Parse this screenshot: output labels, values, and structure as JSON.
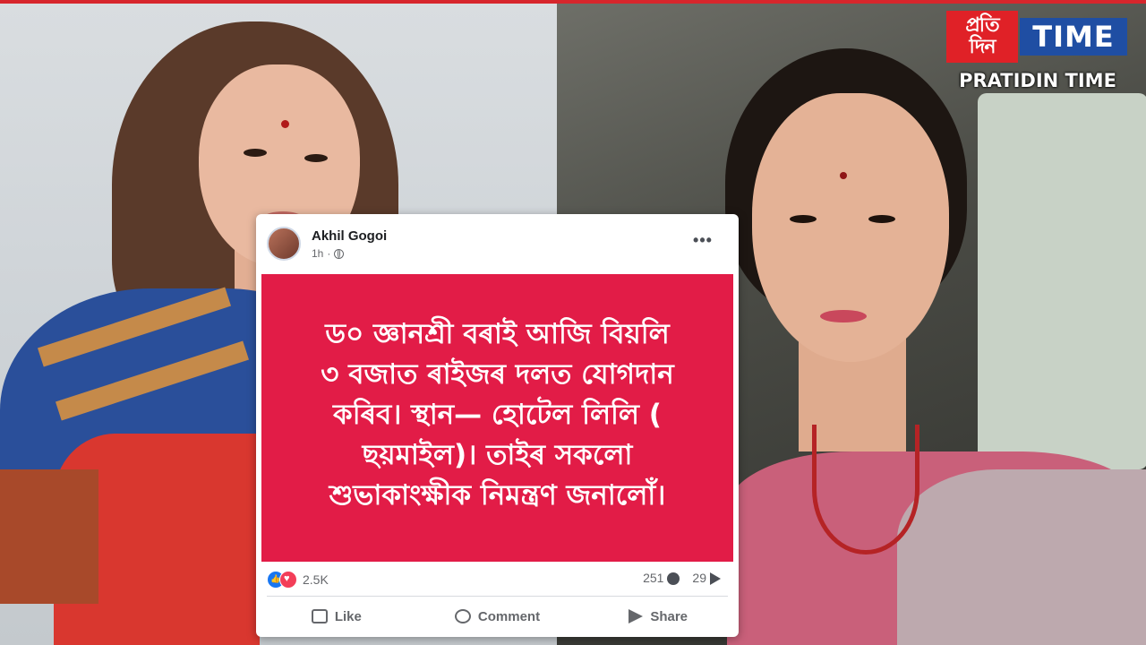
{
  "logo": {
    "mark_line1": "প্রতি",
    "mark_line2": "দিন",
    "time": "TIME",
    "subtitle": "PRATIDIN TIME",
    "brand_red": "#e02127",
    "brand_blue": "#1f4ea3"
  },
  "post": {
    "author": "Akhil Gogoi",
    "time": "1h",
    "audience_icon": "globe-icon",
    "more_label": "•••",
    "background_color": "#e21c47",
    "text_lines": [
      "ড০ জ্ঞানশ্ৰী বৰাই আজি বিয়লি",
      "৩ বজাত ৰাইজৰ দলত যোগদান",
      "কৰিব। স্থান— হোটেল লিলি (",
      "ছয়মাইল)। তাইৰ সকলো",
      "শুভাকাংক্ষীক নিমন্ত্ৰণ জনালোঁ।"
    ],
    "reaction_count": "2.5K",
    "comment_count": "251",
    "share_count": "29",
    "actions": {
      "like": "Like",
      "comment": "Comment",
      "share": "Share"
    }
  }
}
